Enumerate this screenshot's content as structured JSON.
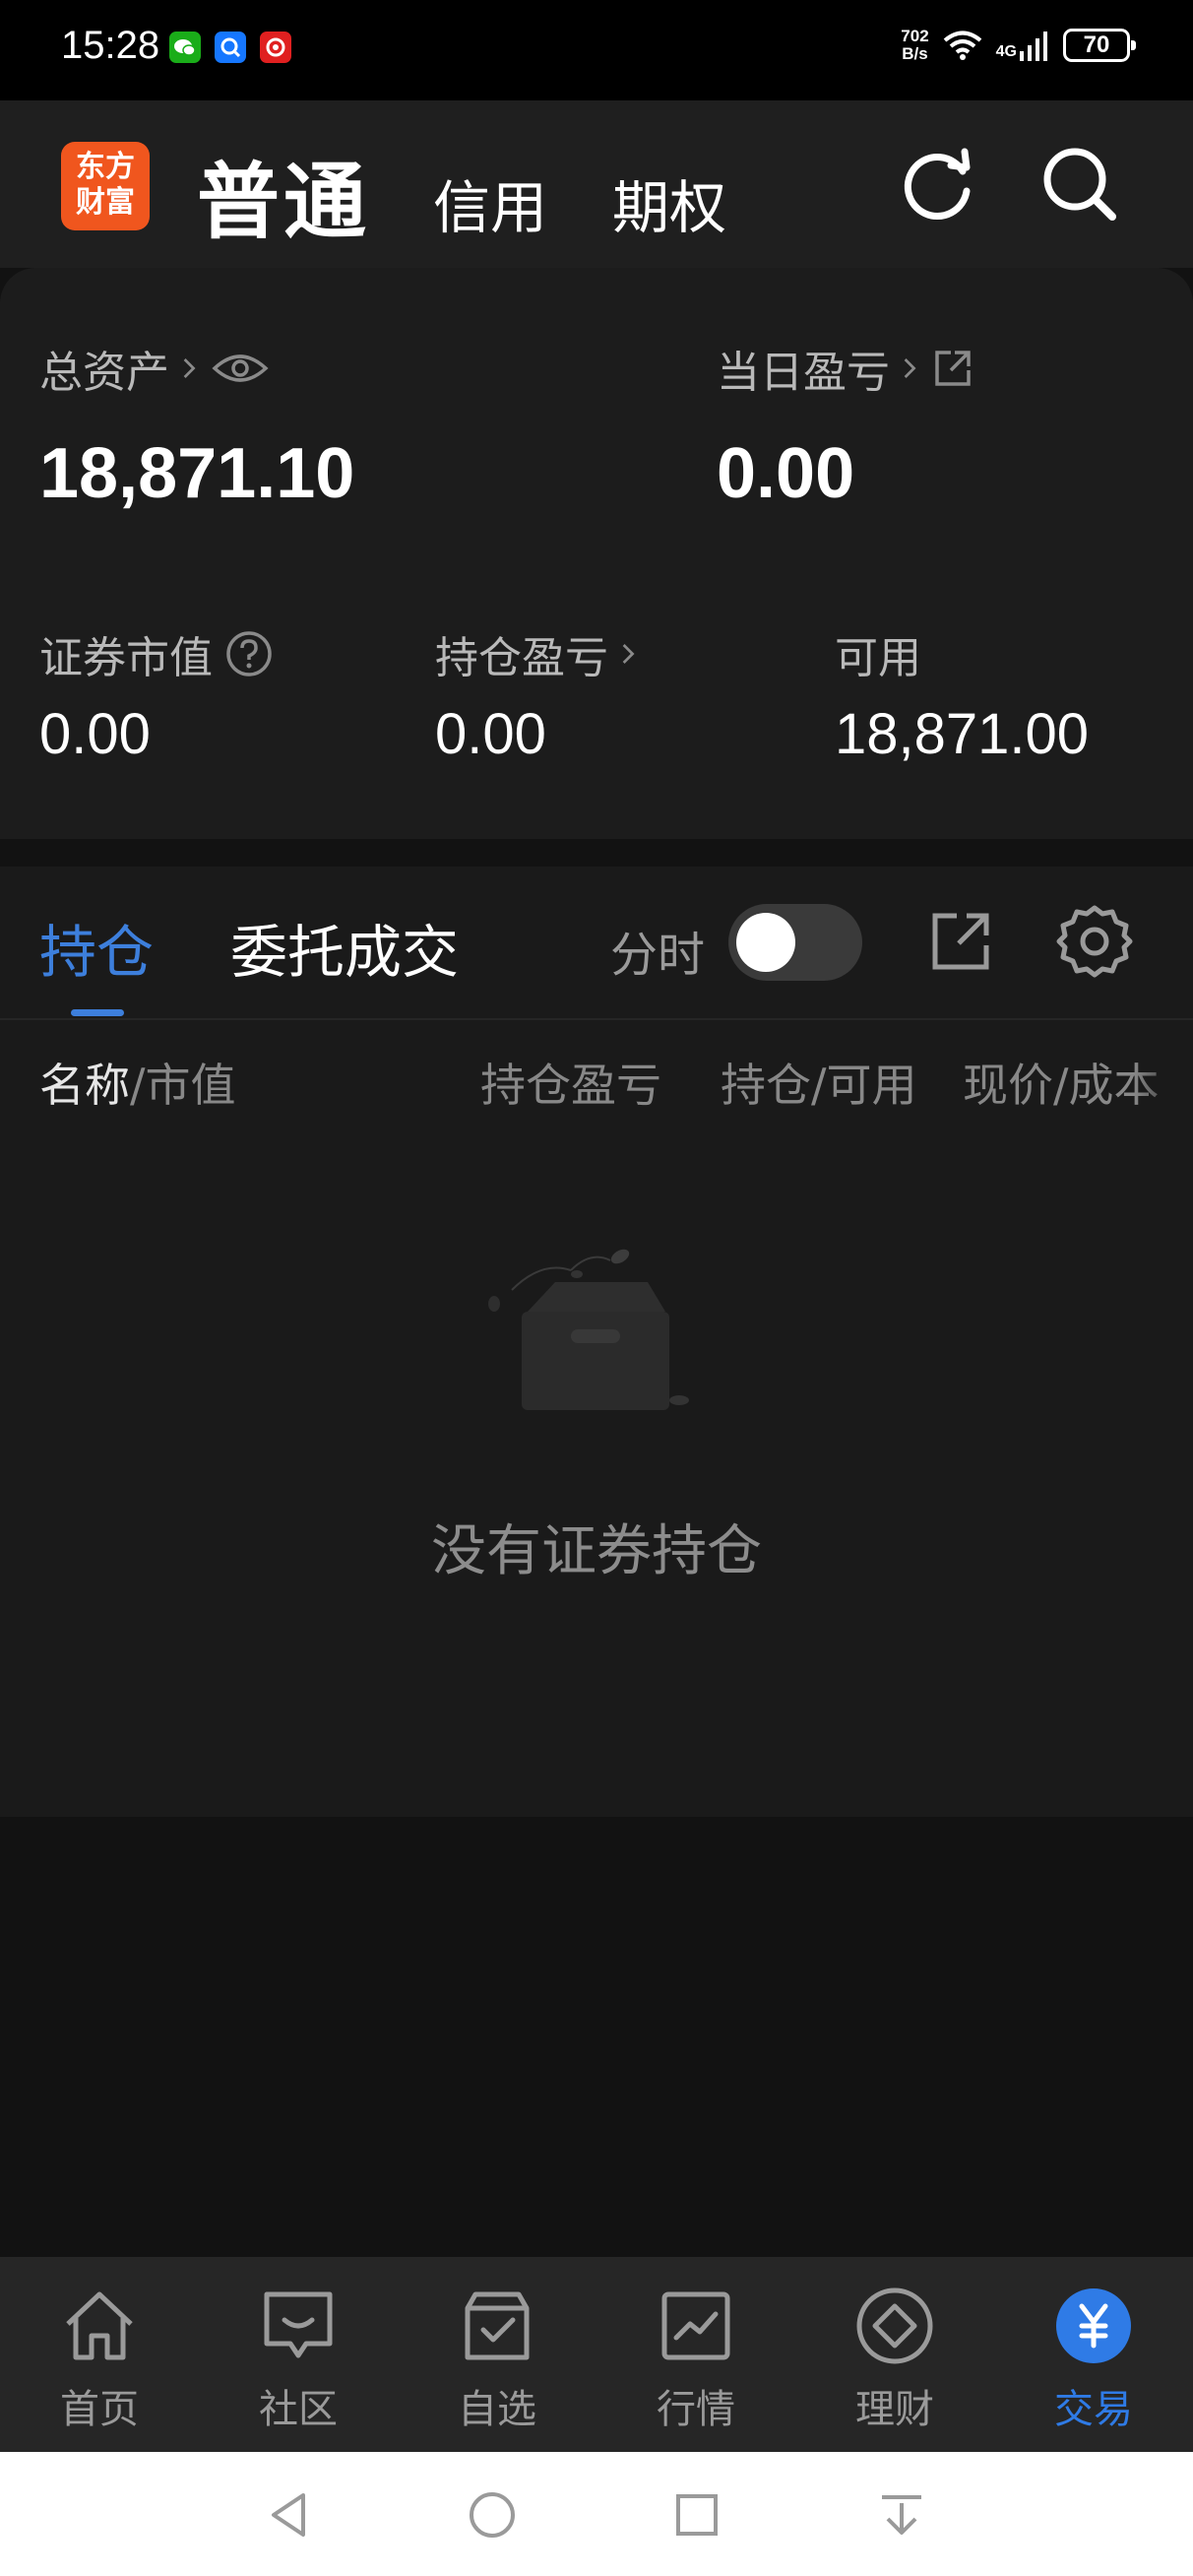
{
  "status_bar": {
    "time": "15:28",
    "apps": [
      {
        "name": "wechat-icon",
        "color": "#1aad19"
      },
      {
        "name": "search-app-icon",
        "color": "#1677ff"
      },
      {
        "name": "red-app-icon",
        "color": "#e02020"
      }
    ],
    "net_speed_value": "702",
    "net_speed_unit": "B/s",
    "network": "4G",
    "battery": "70"
  },
  "header": {
    "logo_line1": "东方",
    "logo_line2": "财富",
    "tab_active": "普通",
    "tab_credit": "信用",
    "tab_options": "期权"
  },
  "summary": {
    "total_assets_label": "总资产",
    "total_assets_value": "18,871.10",
    "daily_pnl_label": "当日盈亏",
    "daily_pnl_value": "0.00",
    "market_value_label": "证券市值",
    "market_value": "0.00",
    "position_pnl_label": "持仓盈亏",
    "position_pnl": "0.00",
    "available_label": "可用",
    "available": "18,871.00"
  },
  "positions": {
    "tab_holdings": "持仓",
    "tab_orders": "委托成交",
    "timeshare_label": "分时",
    "timeshare_on": false,
    "col_name": "名称",
    "col_market_value": "/市值",
    "col_pnl": "持仓盈亏",
    "col_qty": "持仓/可用",
    "col_price": "现价/成本",
    "empty_text": "没有证券持仓"
  },
  "bottom_nav": {
    "items": [
      {
        "label": "首页",
        "icon": "home-icon"
      },
      {
        "label": "社区",
        "icon": "community-icon"
      },
      {
        "label": "自选",
        "icon": "watchlist-icon"
      },
      {
        "label": "行情",
        "icon": "market-icon"
      },
      {
        "label": "理财",
        "icon": "wealth-icon"
      },
      {
        "label": "交易",
        "icon": "trade-icon"
      }
    ],
    "active_index": 5
  },
  "colors": {
    "accent": "#3d7fdc",
    "logo": "#f0561e",
    "background": "#121212"
  }
}
